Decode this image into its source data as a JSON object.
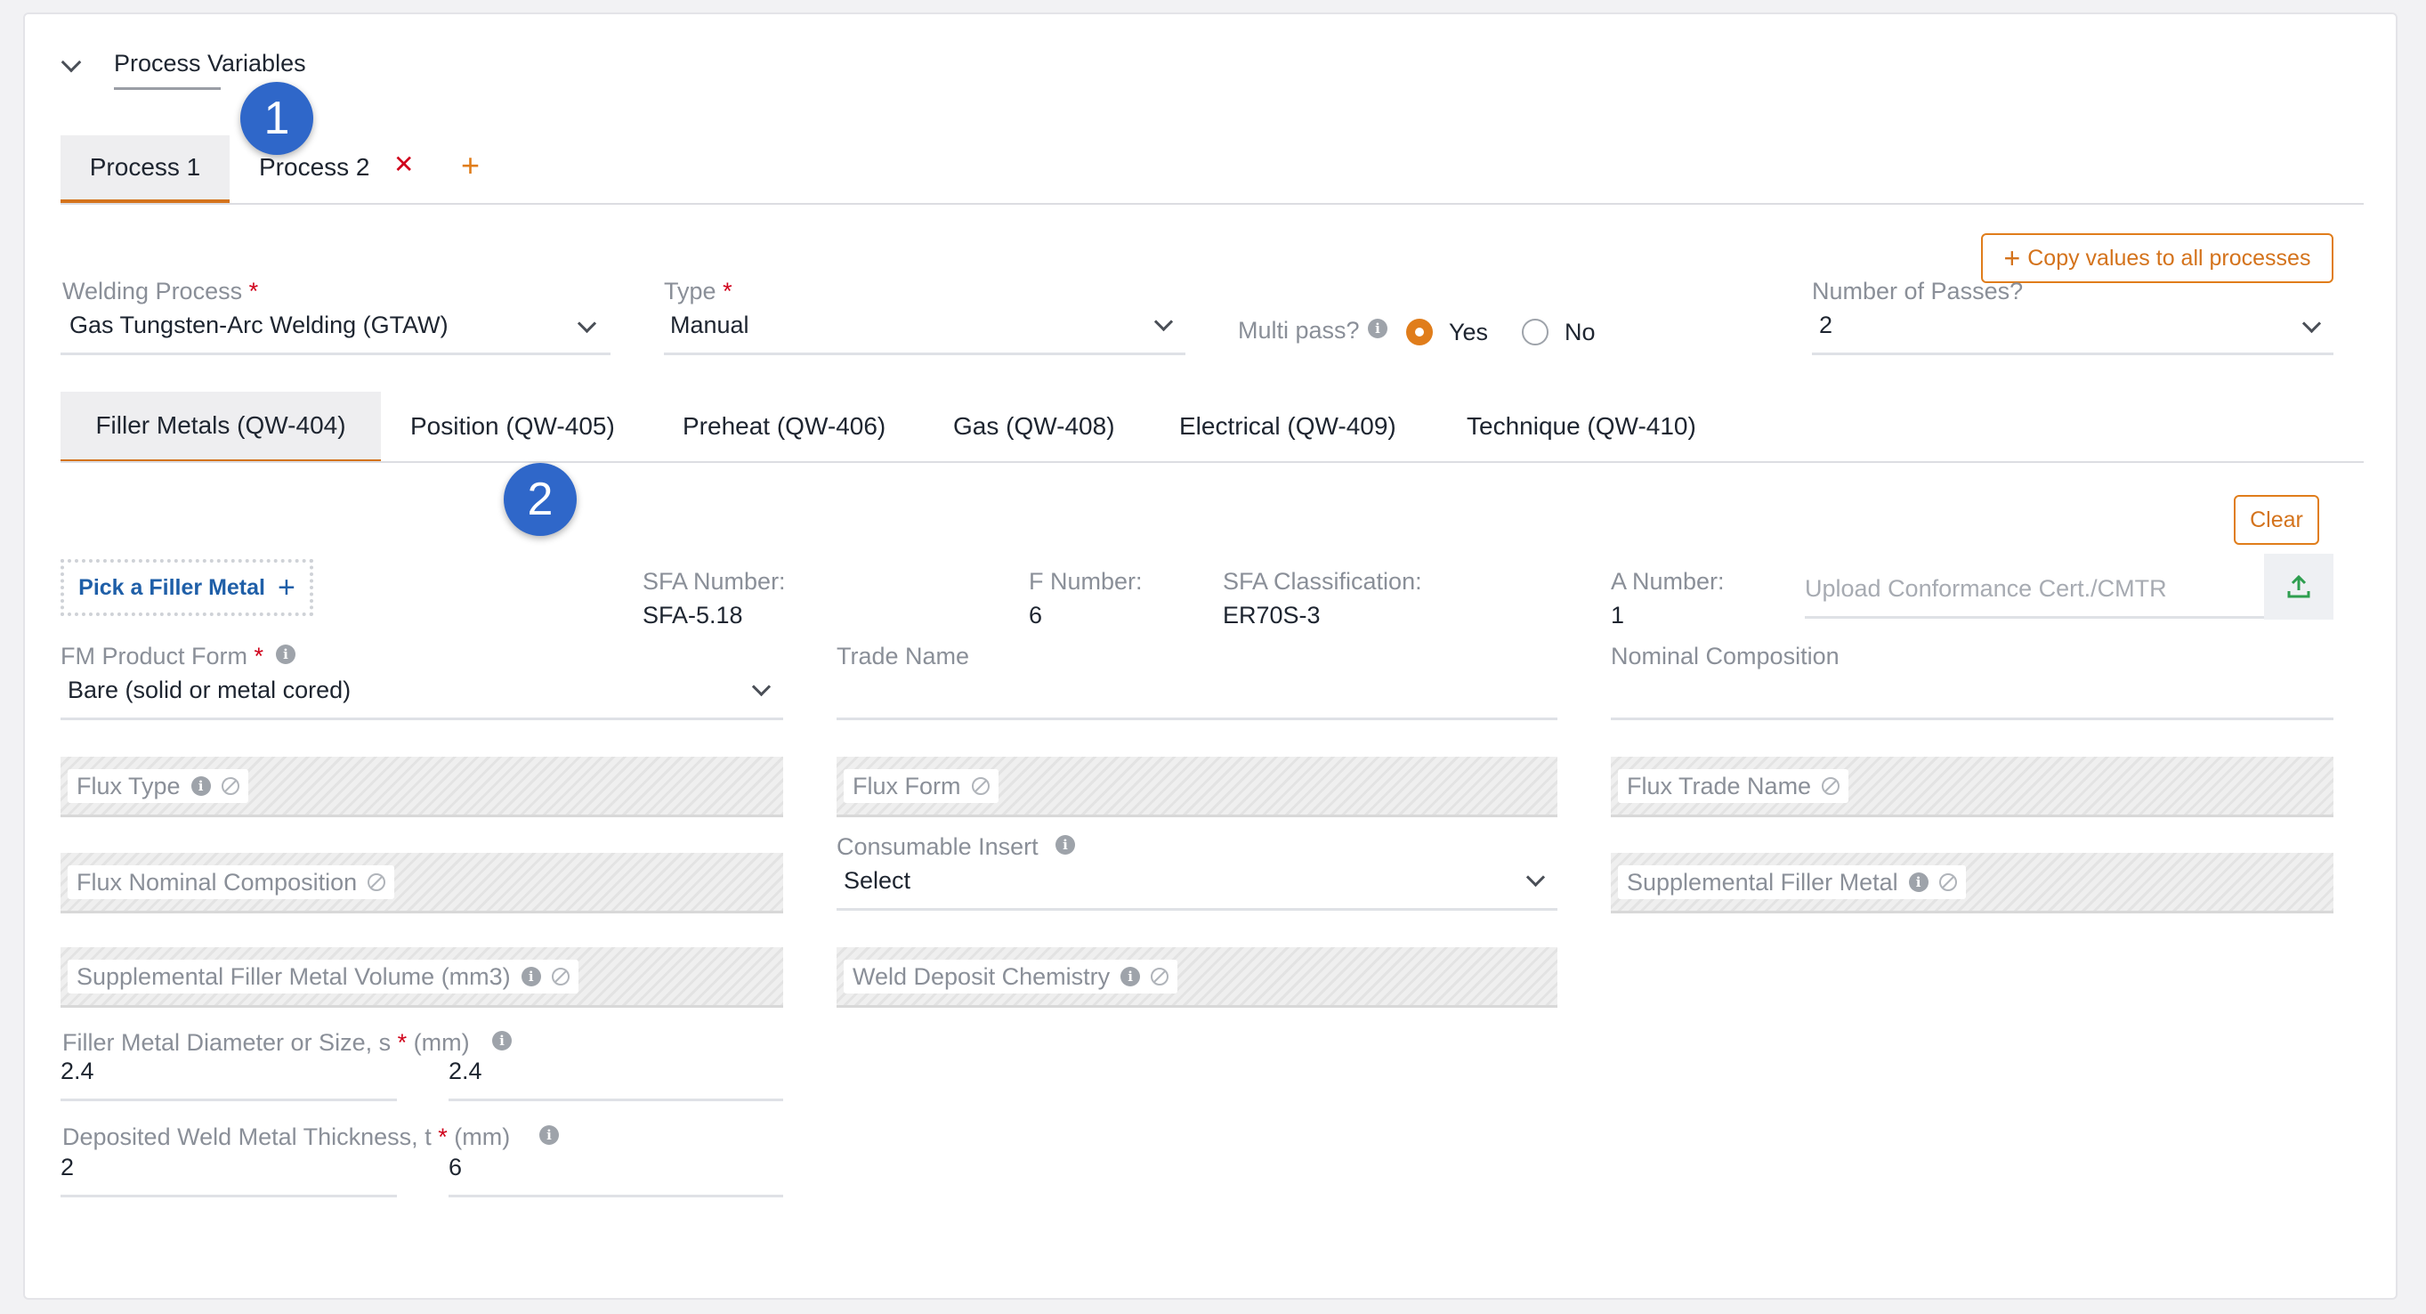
{
  "section": {
    "title": "Process Variables"
  },
  "process_tabs": [
    {
      "label": "Process 1"
    },
    {
      "label": "Process 2"
    }
  ],
  "badges": [
    "1",
    "2"
  ],
  "copy_button": "Copy values to all processes",
  "welding_process": {
    "label": "Welding Process",
    "value": "Gas Tungsten-Arc Welding (GTAW)"
  },
  "type": {
    "label": "Type",
    "value": "Manual"
  },
  "multipass": {
    "label": "Multi pass?",
    "yes": "Yes",
    "no": "No",
    "selected": "Yes"
  },
  "passes": {
    "label": "Number of Passes?",
    "value": "2"
  },
  "sub_tabs": [
    "Filler Metals (QW-404)",
    "Position (QW-405)",
    "Preheat (QW-406)",
    "Gas (QW-408)",
    "Electrical (QW-409)",
    "Technique (QW-410)"
  ],
  "clear_button": "Clear",
  "pick_filler": "Pick a Filler Metal",
  "sfa_number": {
    "label": "SFA Number:",
    "value": "SFA-5.18"
  },
  "f_number": {
    "label": "F Number:",
    "value": "6"
  },
  "sfa_class": {
    "label": "SFA Classification:",
    "value": "ER70S-3"
  },
  "a_number": {
    "label": "A Number:",
    "value": "1"
  },
  "upload": {
    "placeholder": "Upload Conformance Cert./CMTR"
  },
  "fm_form": {
    "label": "FM Product Form",
    "value": "Bare (solid or metal cored)"
  },
  "trade_name": {
    "label": "Trade Name"
  },
  "nominal_comp": {
    "label": "Nominal Composition"
  },
  "flux_type": "Flux Type",
  "flux_form": "Flux Form",
  "flux_trade": "Flux Trade Name",
  "flux_nominal": "Flux Nominal Composition",
  "consumable": {
    "label": "Consumable Insert",
    "value": "Select"
  },
  "supp_filler": "Supplemental Filler Metal",
  "supp_volume": "Supplemental Filler Metal Volume (mm3)",
  "weld_chem": "Weld Deposit Chemistry",
  "diameter": {
    "label_pre": "Filler Metal Diameter or Size, s",
    "label_post": "(mm)",
    "v1": "2.4",
    "v2": "2.4"
  },
  "thickness": {
    "label_pre": "Deposited Weld Metal Thickness, t",
    "label_post": "(mm)",
    "v1": "2",
    "v2": "6"
  },
  "colors": {
    "accent": "#d4731c",
    "required": "#d0021b",
    "badge": "#2f67c9",
    "upload_icon": "#2e9e4f"
  }
}
